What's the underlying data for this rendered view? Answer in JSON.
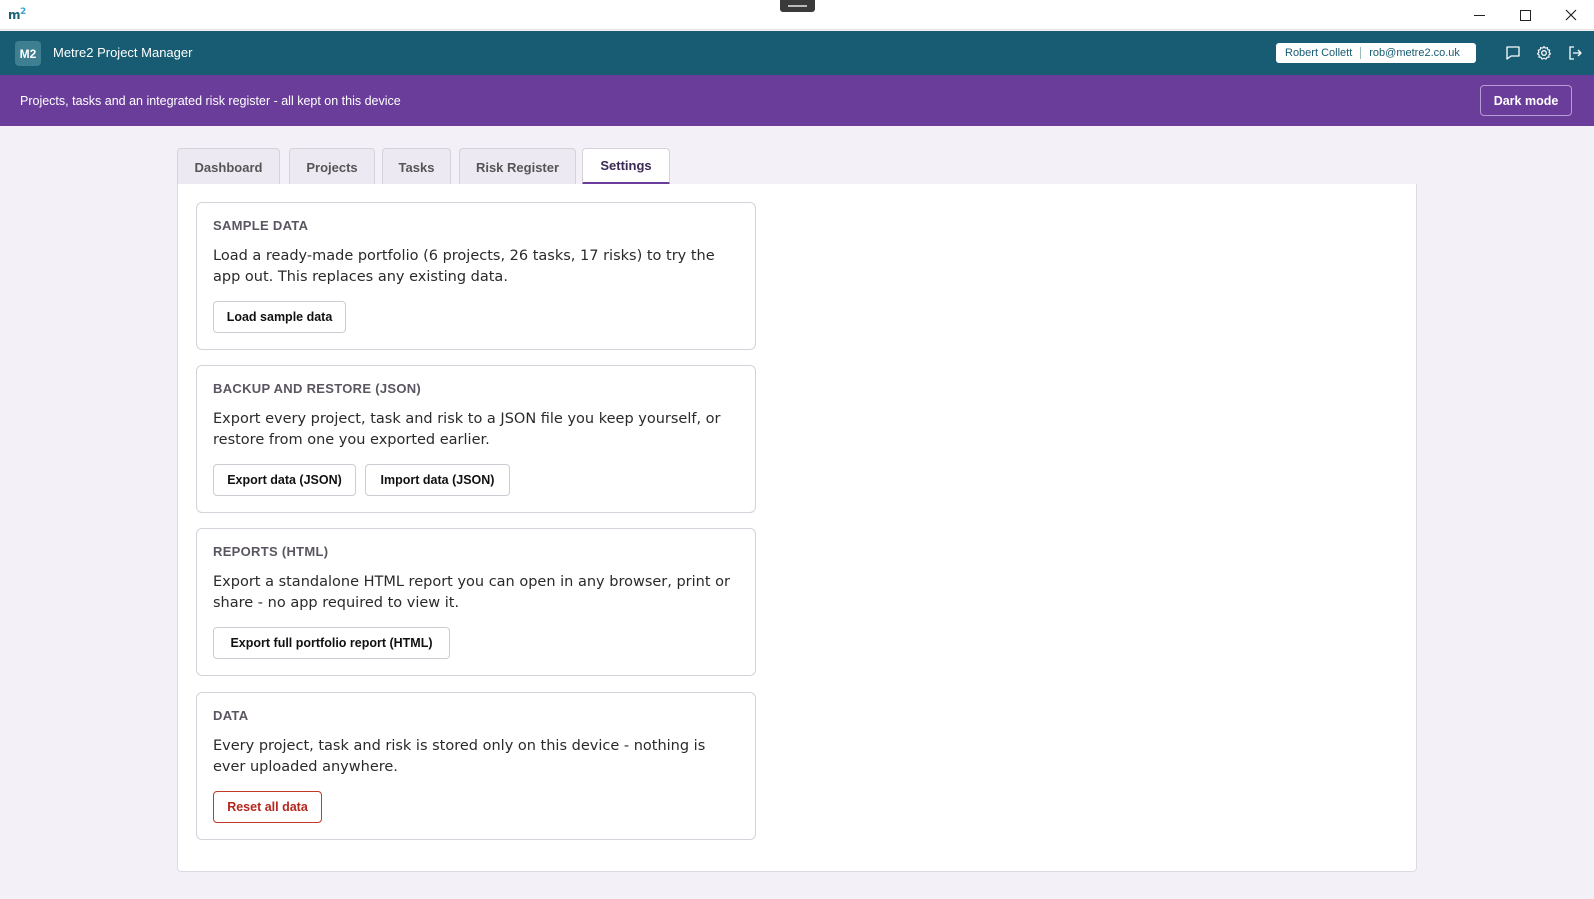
{
  "window": {
    "logo_text": "m",
    "logo_sup": "2"
  },
  "header": {
    "badge": "M2",
    "title": "Metre2 Project Manager",
    "user_name": "Robert Collett",
    "user_email": "rob@metre2.co.uk",
    "icons": [
      "chat-icon",
      "settings-gear-icon",
      "logout-icon"
    ]
  },
  "banner": {
    "tagline": "Projects, tasks and an integrated risk register - all kept on this device",
    "dark_mode_label": "Dark mode"
  },
  "tabs": [
    {
      "label": "Dashboard",
      "active": false
    },
    {
      "label": "Projects",
      "active": false
    },
    {
      "label": "Tasks",
      "active": false
    },
    {
      "label": "Risk Register",
      "active": false
    },
    {
      "label": "Settings",
      "active": true
    }
  ],
  "cards": {
    "sample": {
      "title": "SAMPLE DATA",
      "description": "Load a ready-made portfolio (6 projects, 26 tasks, 17 risks) to try the app out. This replaces any existing data.",
      "button": "Load sample data"
    },
    "backup": {
      "title": "BACKUP AND RESTORE (JSON)",
      "description": "Export every project, task and risk to a JSON file you keep yourself, or restore from one you exported earlier.",
      "export_button": "Export data (JSON)",
      "import_button": "Import data (JSON)"
    },
    "reports": {
      "title": "REPORTS (HTML)",
      "description": "Export a standalone HTML report you can open in any browser, print or share - no app required to view it.",
      "button": "Export full portfolio report (HTML)"
    },
    "data": {
      "title": "DATA",
      "description": "Every project, task and risk is stored only on this device - nothing is ever uploaded anywhere.",
      "button": "Reset all data"
    }
  },
  "colors": {
    "header_teal": "#175c72",
    "banner_purple": "#6a3d9a",
    "danger_red": "#b5271c"
  }
}
